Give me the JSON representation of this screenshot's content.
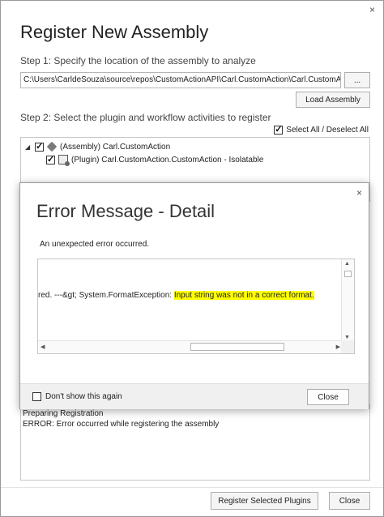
{
  "window": {
    "title": "Register New Assembly",
    "close_glyph": "×"
  },
  "step1": {
    "label": "Step 1: Specify the location of the assembly to analyze",
    "path_value": "C:\\Users\\CarldeSouza\\source\\repos\\CustomActionAPI\\Carl.CustomAction\\Carl.CustomAction\\bin",
    "browse_label": "...",
    "load_button": "Load Assembly"
  },
  "step2": {
    "label": "Step 2: Select the plugin and workflow activities to register",
    "select_all_label": "Select All / Deselect All",
    "select_all_checked": true,
    "tree": [
      {
        "toggle": "◢",
        "label": "(Assembly) Carl.CustomAction",
        "checked": true,
        "icon": "assembly-icon"
      },
      {
        "toggle": "",
        "label": "(Plugin) Carl.CustomAction.CustomAction - Isolatable",
        "checked": true,
        "icon": "plugin-icon"
      }
    ]
  },
  "log": {
    "lines": [
      "Preparing Registration",
      "ERROR: Error occurred while registering the assembly"
    ]
  },
  "footer": {
    "register_button": "Register Selected Plugins",
    "close_button": "Close"
  },
  "dialog": {
    "title": "Error Message - Detail",
    "close_glyph": "×",
    "message": "An unexpected error occurred.",
    "detail_prefix": "red. ---&gt; System.FormatException: ",
    "detail_highlight": "Input string was not in a correct format.",
    "dont_show_label": "Don't show this again",
    "dont_show_checked": false,
    "close_button": "Close",
    "highlight_color": "#ffff00"
  }
}
